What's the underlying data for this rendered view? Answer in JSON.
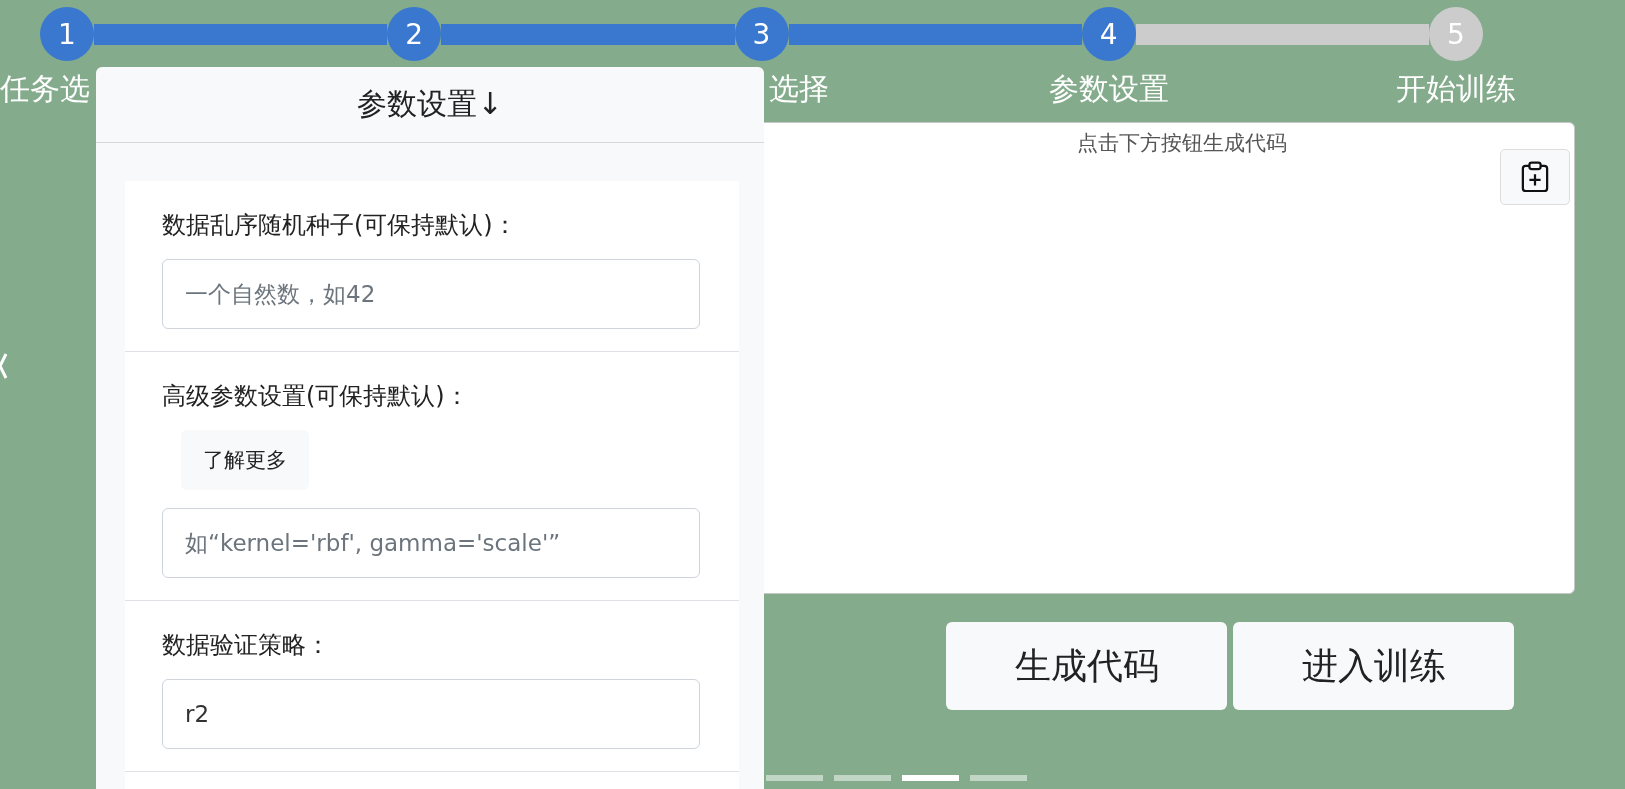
{
  "steps": [
    {
      "number": "1",
      "label": "任务选",
      "kind": "truncated",
      "active": true
    },
    {
      "number": "2",
      "active": true
    },
    {
      "number": "3",
      "label": "选择",
      "kind": "tail",
      "active": true
    },
    {
      "number": "4",
      "label": "参数设置",
      "active": true
    },
    {
      "number": "5",
      "label": "开始训练",
      "active": false
    }
  ],
  "panel": {
    "title": "参数设置↓",
    "sections": [
      {
        "label": "数据乱序随机种子(可保持默认)：",
        "placeholder": "一个自然数，如42"
      },
      {
        "label": "高级参数设置(可保持默认)：",
        "button": "了解更多",
        "placeholder": "如“kernel='rbf', gamma='scale'”"
      },
      {
        "label": "数据验证策略：",
        "value": "r2"
      }
    ]
  },
  "code_box": {
    "hint": "点击下方按钮生成代码"
  },
  "buttons": [
    "生成代码",
    "进入训练"
  ],
  "indicators": [
    {
      "selected": false
    },
    {
      "selected": false
    },
    {
      "selected": true
    },
    {
      "selected": false
    }
  ]
}
